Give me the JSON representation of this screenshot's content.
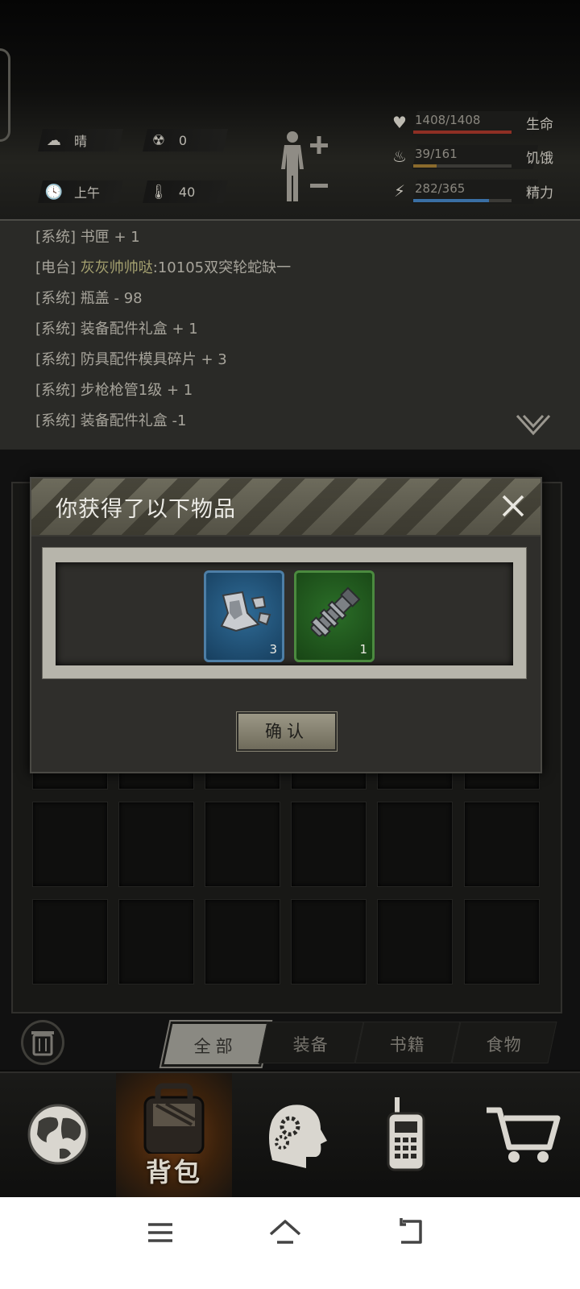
{
  "status": {
    "weather": "晴",
    "radiation": "0",
    "time_of_day": "上午",
    "temperature": "40"
  },
  "vitals": [
    {
      "label": "生命",
      "value": "1408/1408",
      "fraction": 1.0,
      "color": "#8e2f24",
      "icon": "heart-icon"
    },
    {
      "label": "饥饿",
      "value": "39/161",
      "fraction": 0.24,
      "color": "#8a6a2c",
      "icon": "stomach-icon"
    },
    {
      "label": "精力",
      "value": "282/365",
      "fraction": 0.77,
      "color": "#3a6fa4",
      "icon": "energy-icon"
    }
  ],
  "log": {
    "partial_line": "[系统] 书匣 + 1",
    "lines": [
      {
        "tag": "[电台]",
        "name": "灰灰帅帅哒",
        "text": ":10105双突轮蛇缺一"
      },
      {
        "tag": "[系统]",
        "name": "",
        "text": "瓶盖 - 98"
      },
      {
        "tag": "[系统]",
        "name": "",
        "text": "装备配件礼盒 + 1"
      },
      {
        "tag": "[系统]",
        "name": "",
        "text": "防具配件模具碎片 + 3"
      },
      {
        "tag": "[系统]",
        "name": "",
        "text": "步枪枪管1级 + 1"
      },
      {
        "tag": "[系统]",
        "name": "",
        "text": "装备配件礼盒 -1"
      }
    ]
  },
  "dialog": {
    "title": "你获得了以下物品",
    "items": [
      {
        "name": "armor-mold-fragment",
        "count": "3",
        "rarity": "blue"
      },
      {
        "name": "rifle-barrel",
        "count": "1",
        "rarity": "green"
      }
    ],
    "confirm_label": "确认"
  },
  "inventory_tabs": [
    "全部",
    "装备",
    "书籍",
    "食物"
  ],
  "game_nav": {
    "items": [
      "world-map",
      "backpack",
      "skills",
      "radio",
      "shop"
    ],
    "active_label": "背包"
  }
}
